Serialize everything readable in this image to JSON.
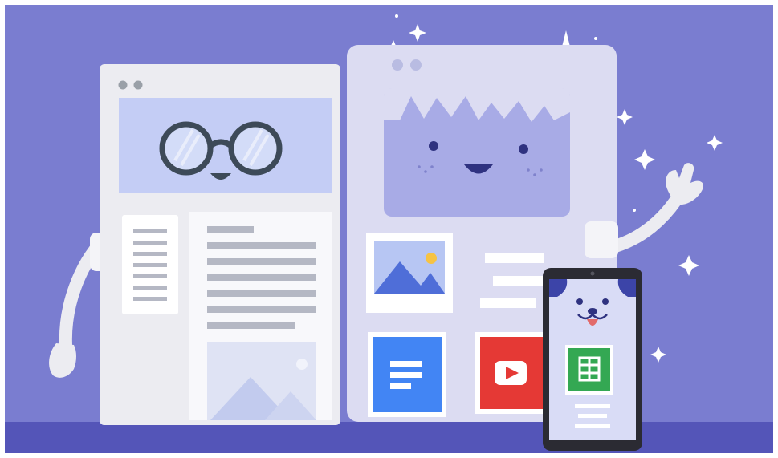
{
  "scene": {
    "subject": "",
    "colors": {
      "background": "#7a7dd0",
      "floor": "#5455b8",
      "window_light": "#ececf1",
      "window_blue_tint": "#dcdcf2",
      "header_blue": "#c4cdf5",
      "face_panel": "#a8abe6",
      "glasses": "#3d4a58",
      "doc_blue": "#4285f4",
      "youtube_red": "#e53935",
      "sheets_green": "#34a853",
      "phone_frame": "#2b2b33",
      "phone_screen": "#d9dcf6"
    },
    "icons": [
      "sparkle-icon",
      "image-placeholder-icon",
      "document-icon",
      "play-button-icon",
      "spreadsheet-icon"
    ]
  }
}
